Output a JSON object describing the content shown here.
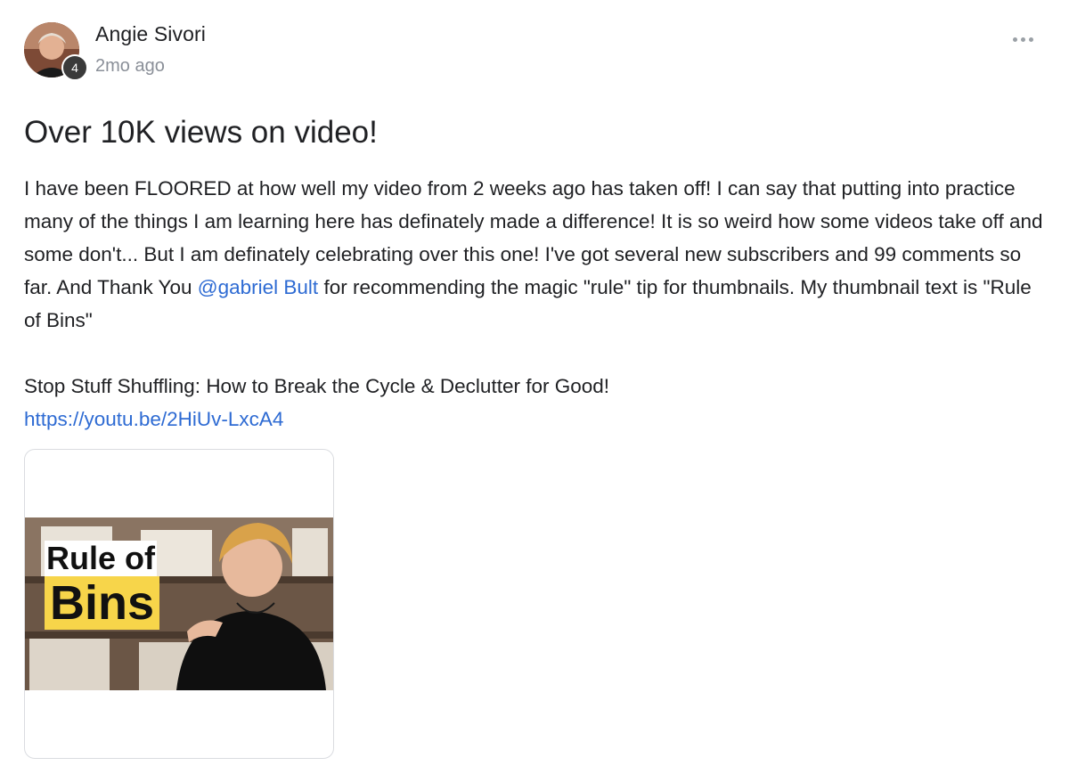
{
  "post": {
    "author": {
      "name": "Angie Sivori",
      "level": "4",
      "time": "2mo ago"
    },
    "more_icon": "more-horizontal-icon",
    "title": "Over 10K views on video!",
    "body": {
      "para1_before": "I have been FLOORED at how well my video from 2 weeks ago has taken off! I can say that putting into practice many of the things I am learning here has definately made a difference! It is so weird how some videos take off and some don't... But I am definately celebrating over this one! I've got several new subscribers and 99 comments so far. And Thank You ",
      "mention": "@gabriel Bult",
      "para1_after": " for recommending the magic \"rule\" tip for thumbnails. My thumbnail text is \"Rule of Bins\"",
      "video_title": "Stop Stuff Shuffling: How to Break the Cycle & Declutter for Good!",
      "link": "https://youtu.be/2HiUv-LxcA4"
    },
    "video_card": {
      "thumb_line1": "Rule of",
      "thumb_line2": "Bins"
    },
    "colors": {
      "link": "#2e6bd3",
      "badge": "#3a3a3a",
      "thumb_highlight": "#f7d54a"
    }
  }
}
